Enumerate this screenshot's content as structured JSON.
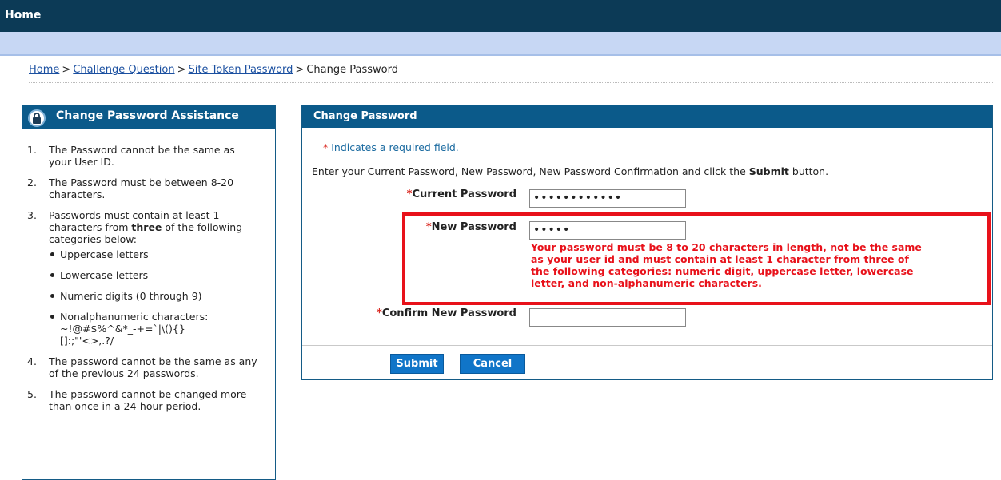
{
  "header": {
    "title": "Home"
  },
  "breadcrumb": {
    "items": [
      "Home",
      "Challenge Question",
      "Site Token Password"
    ],
    "current": "Change Password",
    "separator": ">"
  },
  "assistance": {
    "title": "Change Password Assistance",
    "icon": "lock-icon",
    "rules": [
      {
        "num": "1.",
        "text": "The Password cannot be the same as your User ID."
      },
      {
        "num": "2.",
        "text": "The Password must be between 8-20 characters."
      },
      {
        "num": "3.",
        "text_before": "Passwords must contain at least 1 characters from ",
        "bold": "three",
        "text_after": " of the following categories below:"
      },
      {
        "num": "4.",
        "text": "The password cannot be the same as any of the previous 24 passwords."
      },
      {
        "num": "5.",
        "text": "The password cannot be changed more than once in a 24-hour period."
      }
    ],
    "categories": [
      "Uppercase letters",
      "Lowercase letters",
      "Numeric digits (0 through 9)",
      "Nonalphanumeric characters: ~!@#$%^&*_-+=`|\\(){}[]:;\"'<>,.?/"
    ]
  },
  "form": {
    "title": "Change Password",
    "required_star": "*",
    "required_note": " Indicates a required field.",
    "instruction_before": "Enter your Current Password, New Password, New Password Confirmation and click the ",
    "instruction_bold": "Submit",
    "instruction_after": " button.",
    "fields": {
      "current": {
        "label": "Current Password",
        "value": "••••••••••••"
      },
      "new": {
        "label": "New Password",
        "value": "•••••"
      },
      "confirm": {
        "label": "Confirm New Password",
        "value": ""
      }
    },
    "error": "Your password must be 8 to 20 characters in length, not be the same as your user id and must contain at least 1 character from three of the following categories: numeric digit, uppercase letter, lowercase letter, and non-alphanumeric characters.",
    "buttons": {
      "submit": "Submit",
      "cancel": "Cancel"
    }
  },
  "colors": {
    "header": "#0c3a56",
    "panel_header": "#0b5a8a",
    "subbar": "#c7d7f4",
    "error": "#e8111a",
    "button": "#1075c8",
    "link": "#1a4fa0"
  }
}
